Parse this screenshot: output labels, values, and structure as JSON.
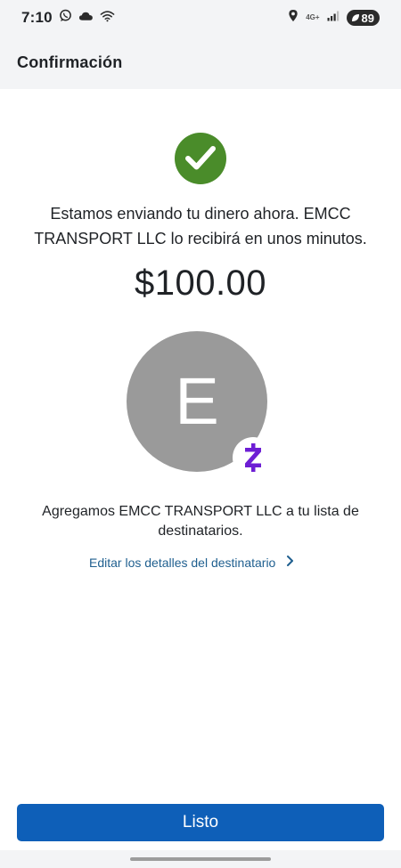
{
  "status_bar": {
    "time": "7:10",
    "network": "4G+",
    "battery": "89",
    "icons": [
      "whatsapp-icon",
      "cloud-icon",
      "wifi-icon",
      "location-icon",
      "signal-icon",
      "battery-icon"
    ]
  },
  "header": {
    "title": "Confirmación"
  },
  "confirmation": {
    "message": "Estamos enviando tu dinero ahora. EMCC TRANSPORT LLC lo recibirá en unos minutos.",
    "amount": "$100.00",
    "recipient_initial": "E",
    "added_message": "Agregamos EMCC TRANSPORT LLC a tu lista de destinatarios.",
    "edit_link": "Editar los detalles del destinatario"
  },
  "actions": {
    "done_label": "Listo"
  },
  "colors": {
    "success": "#4a8c2a",
    "avatar": "#9a9a9a",
    "zelle": "#6d1ed4",
    "link": "#1f5f8f",
    "primary_button": "#0e5fb8"
  }
}
